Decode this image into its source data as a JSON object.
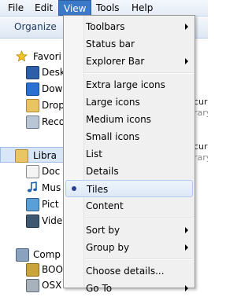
{
  "menubar": {
    "items": [
      {
        "label": "File"
      },
      {
        "label": "Edit"
      },
      {
        "label": "View"
      },
      {
        "label": "Tools"
      },
      {
        "label": "Help"
      }
    ],
    "active": "View"
  },
  "commandbar": {
    "organize_label": "Organize"
  },
  "nav": {
    "favorites": "Favori",
    "desktop": "Desk",
    "downloads": "Dow",
    "dropbox": "Drop",
    "recent": "Reco",
    "libraries": "Libra",
    "documents": "Doc",
    "music": "Mus",
    "pictures": "Pict",
    "videos": "Vide",
    "computer": "Comp",
    "drive1": "BOO",
    "drive2": "OSX"
  },
  "content": {
    "frag1": "cur",
    "frag1_sub": "rary",
    "frag2": "cur",
    "frag2_sub": "rary"
  },
  "view_menu": {
    "toolbars": "Toolbars",
    "status_bar": "Status bar",
    "explorer_bar": "Explorer Bar",
    "extra_large_icons": "Extra large icons",
    "large_icons": "Large icons",
    "medium_icons": "Medium icons",
    "small_icons": "Small icons",
    "list": "List",
    "details": "Details",
    "tiles": "Tiles",
    "content": "Content",
    "sort_by": "Sort by",
    "group_by": "Group by",
    "choose_details": "Choose details...",
    "go_to": "Go To",
    "selected": "Tiles"
  },
  "colors": {
    "menu_highlight": "#3a78c8",
    "radio_dot": "#2b3f8f"
  }
}
